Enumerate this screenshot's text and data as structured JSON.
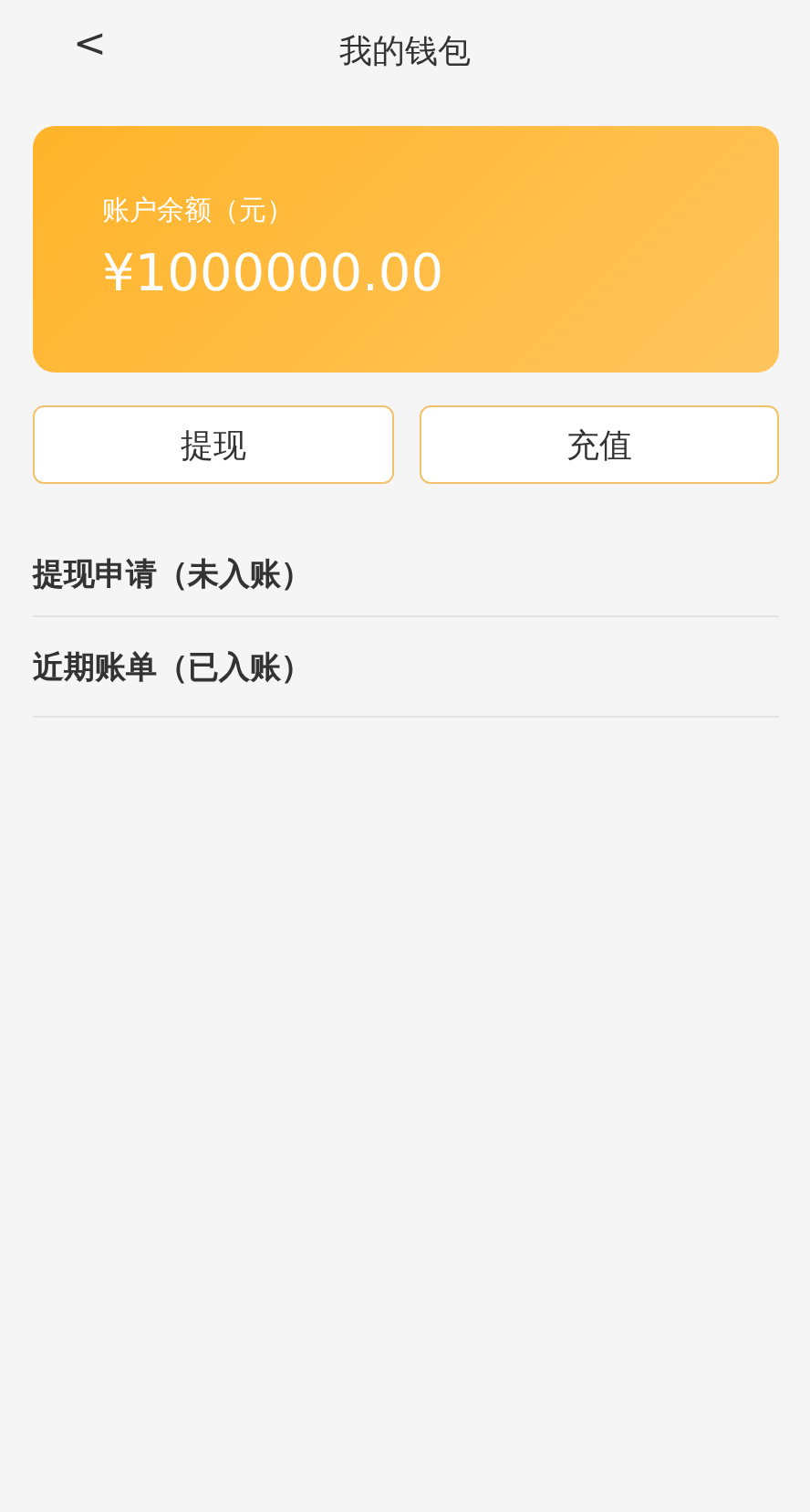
{
  "header": {
    "back": "<",
    "title": "我的钱包"
  },
  "balance": {
    "label": "账户余额（元）",
    "amount": "¥1000000.00"
  },
  "buttons": [
    "提现",
    "充值"
  ],
  "sections": [
    {
      "title": "提现申请（未入账）"
    },
    {
      "title": "近期账单（已入账）"
    }
  ]
}
